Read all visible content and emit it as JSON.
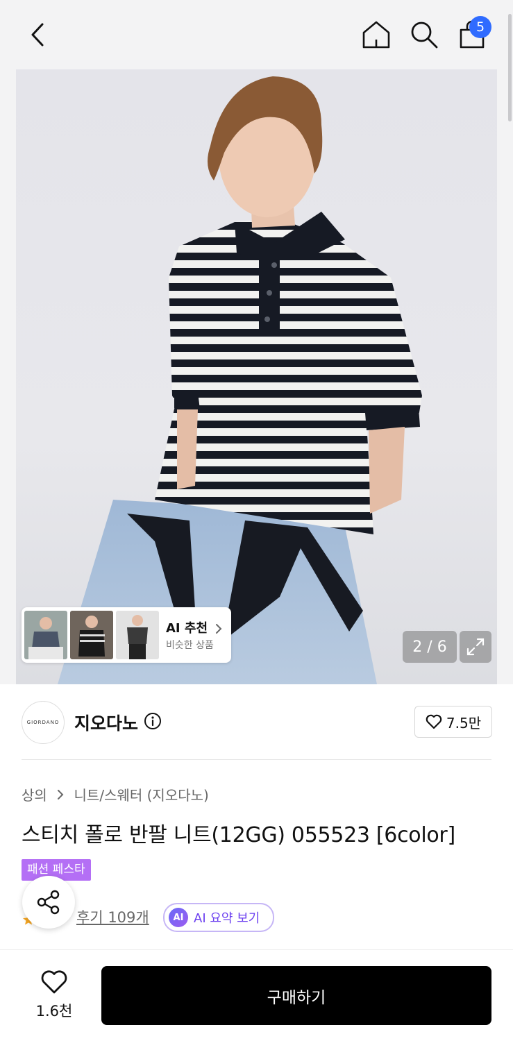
{
  "header": {
    "cart_count": "5"
  },
  "gallery": {
    "counter": "2 / 6",
    "ai_card": {
      "title": "AI 추천",
      "subtitle": "비슷한 상품"
    }
  },
  "brand": {
    "logo_text": "GIORDANO",
    "name": "지오다노",
    "likes": "7.5만"
  },
  "breadcrumb": {
    "level1": "상의",
    "level2": "니트/스웨터 (지오다노)"
  },
  "product": {
    "title": "스티치 폴로 반팔 니트(12GG) 055523 [6color]",
    "promo_tag": "패션 페스타",
    "reviews": "후기 109개",
    "ai_summary_badge": "AI",
    "ai_summary_label": "AI 요약 보기"
  },
  "bottom_bar": {
    "wish_count": "1.6천",
    "buy_label": "구매하기"
  },
  "colors": {
    "accent_blue": "#2f6bff",
    "promo_purple": "#b46ff5",
    "ai_purple": "#6b3ff0"
  }
}
